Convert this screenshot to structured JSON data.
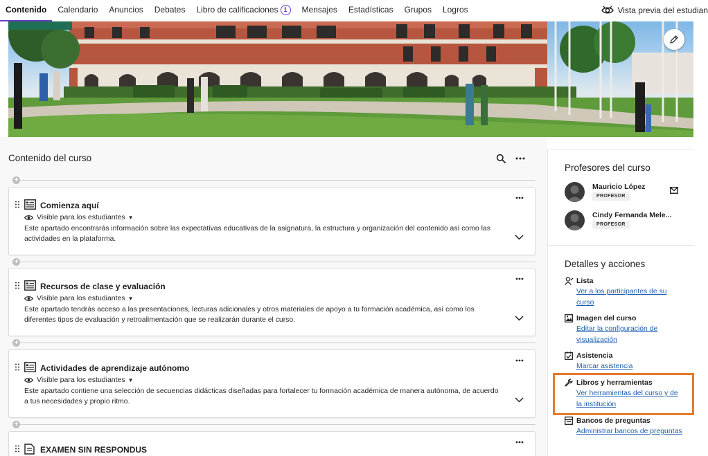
{
  "nav": {
    "tabs": [
      {
        "label": "Contenido"
      },
      {
        "label": "Calendario"
      },
      {
        "label": "Anuncios"
      },
      {
        "label": "Debates"
      },
      {
        "label": "Libro de calificaciones",
        "badge": "1"
      },
      {
        "label": "Mensajes"
      },
      {
        "label": "Estadísticas"
      },
      {
        "label": "Grupos"
      },
      {
        "label": "Logros"
      }
    ],
    "preview_label": "Vista previa del estudian"
  },
  "content": {
    "header": "Contenido del curso",
    "items": [
      {
        "title": "Comienza aquí",
        "visibility": "Visible para los estudiantes",
        "description": "Este apartado encontrarás información sobre las expectativas educativas de la asignatura, la estructura y organización del contenido así como las actividades en la plataforma."
      },
      {
        "title": "Recursos de clase y evaluación",
        "visibility": "Visible para los estudiantes",
        "description": "Este apartado tendrás acceso a las presentaciones, lecturas adicionales y otros materiales de apoyo a tu formación académica, así como los diferentes tipos de evaluación y retroalimentación que se realizarán durante el curso."
      },
      {
        "title": "Actividades de aprendizaje autónomo",
        "visibility": "Visible para los estudiantes",
        "description": "Este apartado contiene una selección de secuencias didácticas diseñadas para fortalecer tu formación académica de manera autónoma, de acuerdo a tus necesidades y propio ritmo."
      },
      {
        "title": "EXAMEN SIN RESPONDUS",
        "visibility": "",
        "description": ""
      }
    ]
  },
  "sidebar": {
    "professors_title": "Profesores del curso",
    "professors": [
      {
        "name": "Mauricio López",
        "role": "PROFESOR"
      },
      {
        "name": "Cindy Fernanda Mele...",
        "role": "PROFESOR"
      }
    ],
    "details_title": "Detalles y acciones",
    "actions": [
      {
        "title": "Lista",
        "link": "Ver a los participantes de su curso"
      },
      {
        "title": "Imagen del curso",
        "link": "Editar la configuración de visualización"
      },
      {
        "title": "Asistencia",
        "link": "Marcar asistencia"
      },
      {
        "title": "Libros y herramientas",
        "link": "Ver herramientas del curso y de la institución"
      },
      {
        "title": "Bancos de preguntas",
        "link": "Administrar bancos de preguntas"
      }
    ]
  },
  "colors": {
    "accent": "#6c3ec1",
    "link": "#1f5fb0",
    "highlight_box": "#e57a2e"
  },
  "icons": [
    "eye-preview-icon",
    "pencil-icon",
    "search-icon",
    "more-icon",
    "drag-handle-icon",
    "document-icon",
    "eye-icon",
    "chevron-down-icon",
    "mail-icon",
    "roster-icon",
    "image-icon",
    "attendance-icon",
    "wrench-icon",
    "question-bank-icon"
  ]
}
